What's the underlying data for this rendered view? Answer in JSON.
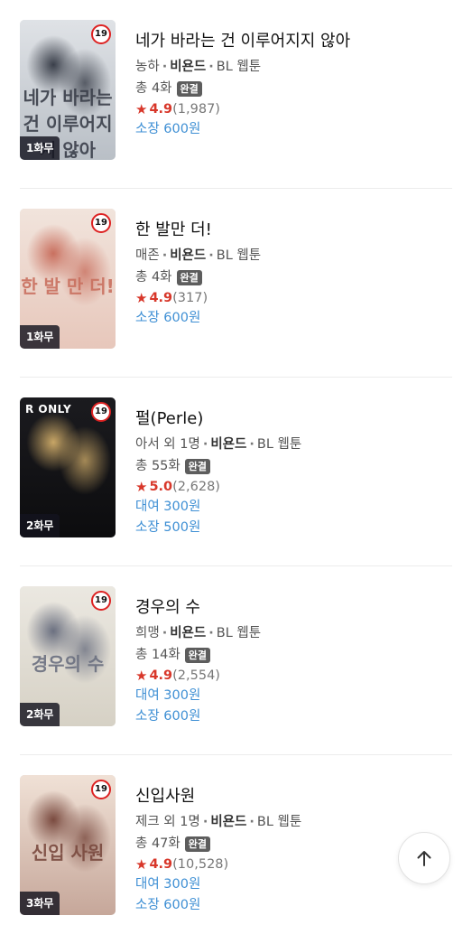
{
  "items": [
    {
      "title": "네가 바라는 건 이루어지지 않아",
      "author": "농하",
      "genre": "비욘드",
      "category": "BL 웹툰",
      "episodes": "총 4화",
      "status": "완결",
      "score": "4.9",
      "count": "(1,987)",
      "prices": [
        "소장 600원"
      ],
      "age": "19",
      "free": "1화무",
      "cover_title": "네가 바라는 건 이루어지지 않아",
      "cover_colors": {
        "top": "#dfe2e6",
        "bottom": "#b9bfc6",
        "figure": "#3a3f4a"
      }
    },
    {
      "title": "한 발만 더!",
      "author": "매존",
      "genre": "비욘드",
      "category": "BL 웹툰",
      "episodes": "총 4화",
      "status": "완결",
      "score": "4.9",
      "count": "(317)",
      "prices": [
        "소장 600원"
      ],
      "age": "19",
      "free": "1화무",
      "cover_title": "한 발 만 더!",
      "cover_colors": {
        "top": "#f1e4dc",
        "bottom": "#e7c7bb",
        "figure": "#c9705f"
      }
    },
    {
      "title": "펄(Perle)",
      "author": "아서 외 1명",
      "genre": "비욘드",
      "category": "BL 웹툰",
      "episodes": "총 55화",
      "status": "완결",
      "score": "5.0",
      "count": "(2,628)",
      "prices": [
        "대여 300원",
        "소장 500원"
      ],
      "age": "19",
      "free": "2화무",
      "ronly": "R ONLY",
      "cover_colors": {
        "top": "#1b1b1f",
        "bottom": "#0c0c0e",
        "figure": "#c8a666"
      }
    },
    {
      "title": "경우의 수",
      "author": "희맹",
      "genre": "비욘드",
      "category": "BL 웹툰",
      "episodes": "총 14화",
      "status": "완결",
      "score": "4.9",
      "count": "(2,554)",
      "prices": [
        "대여 300원",
        "소장 600원"
      ],
      "age": "19",
      "free": "2화무",
      "cover_title": "경우의 수",
      "cover_colors": {
        "top": "#ebe8e1",
        "bottom": "#d6d1c5",
        "figure": "#6b7080"
      }
    },
    {
      "title": "신입사원",
      "author": "제크 외 1명",
      "genre": "비욘드",
      "category": "BL 웹툰",
      "episodes": "총 47화",
      "status": "완결",
      "score": "4.9",
      "count": "(10,528)",
      "prices": [
        "대여 300원",
        "소장 600원"
      ],
      "age": "19",
      "free": "3화무",
      "cover_title": "신입 사원",
      "cover_colors": {
        "top": "#f0e1d6",
        "bottom": "#c6a79a",
        "figure": "#7a4a3f"
      }
    }
  ],
  "scroll_top_icon": "arrow-up-icon"
}
